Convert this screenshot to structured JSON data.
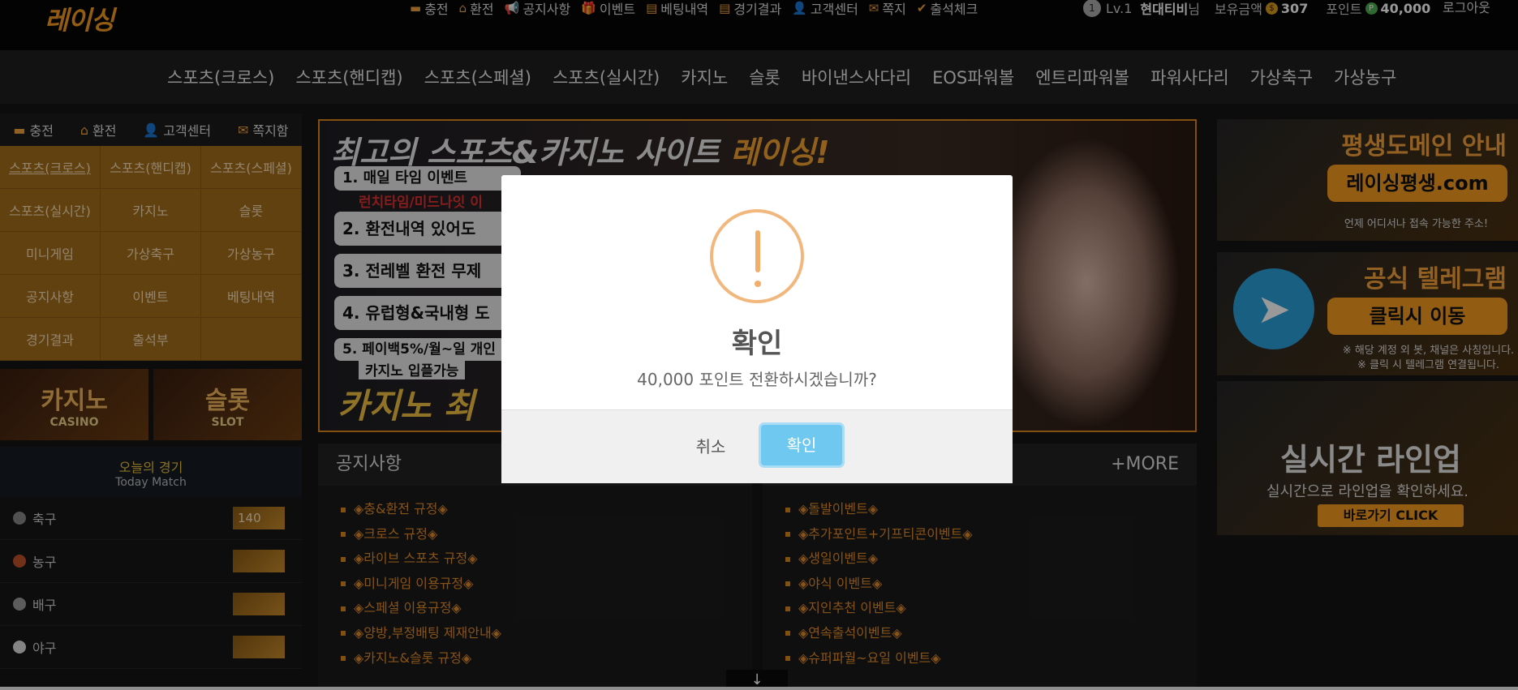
{
  "logo": {
    "text": "레이싱"
  },
  "toplinks": [
    {
      "icon": "card-icon",
      "glyph": "▬",
      "label": "충전"
    },
    {
      "icon": "exchange-icon",
      "glyph": "⌂",
      "label": "환전"
    },
    {
      "icon": "megaphone-icon",
      "glyph": "📢",
      "label": "공지사항"
    },
    {
      "icon": "gift-icon",
      "glyph": "🎁",
      "label": "이벤트"
    },
    {
      "icon": "doc-icon",
      "glyph": "▤",
      "label": "베팅내역"
    },
    {
      "icon": "doc2-icon",
      "glyph": "▤",
      "label": "경기결과"
    },
    {
      "icon": "support-icon",
      "glyph": "👤",
      "label": "고객센터"
    },
    {
      "icon": "ribbon-icon",
      "glyph": "✉",
      "label": "쪽지"
    },
    {
      "icon": "check-icon",
      "glyph": "✔",
      "label": "출석체크"
    }
  ],
  "user": {
    "level_badge": "1",
    "level": "Lv.1",
    "name": "현대티비",
    "suffix": "님",
    "balance_label": "보유금액",
    "balance": "307",
    "points_label": "포인트",
    "points": "40,000",
    "balance_coin": "$",
    "points_coin": "P"
  },
  "logout": "로그아웃",
  "mainnav": [
    "스포츠(크로스)",
    "스포츠(핸디캡)",
    "스포츠(스페셜)",
    "스포츠(실시간)",
    "카지노",
    "슬롯",
    "바이낸스사다리",
    "EOS파워볼",
    "엔트리파워볼",
    "파워사다리",
    "가상축구",
    "가상농구"
  ],
  "sidebar": {
    "quick": [
      {
        "icon": "card-icon",
        "glyph": "▬",
        "label": "충전"
      },
      {
        "icon": "exchange-icon",
        "glyph": "⌂",
        "label": "환전"
      },
      {
        "icon": "support-icon",
        "glyph": "👤",
        "label": "고객센터"
      },
      {
        "icon": "ribbon-icon",
        "glyph": "✉",
        "label": "쪽지함"
      }
    ],
    "grid": [
      "스포츠(크로스)",
      "스포츠(핸디캡)",
      "스포츠(스페셜)",
      "스포츠(실시간)",
      "카지노",
      "슬롯",
      "미니게임",
      "가상축구",
      "가상농구",
      "공지사항",
      "이벤트",
      "베팅내역",
      "경기결과",
      "출석부",
      ""
    ],
    "banners": [
      {
        "title": "카지노",
        "sub": "CASINO"
      },
      {
        "title": "슬롯",
        "sub": "SLOT"
      }
    ],
    "today": {
      "title": "오늘의 경기",
      "subtitle": "Today Match"
    },
    "sports": [
      {
        "name": "축구",
        "count": "140",
        "color": "#888"
      },
      {
        "name": "농구",
        "count": "",
        "color": "#c0502a"
      },
      {
        "name": "배구",
        "count": "",
        "color": "#999"
      },
      {
        "name": "야구",
        "count": "",
        "color": "#ddd"
      }
    ]
  },
  "hero": {
    "title_a": "최고의 스포츠&카지노 사이트",
    "title_b": "레이싱!",
    "items": [
      "1. 매일 타임 이벤트",
      "2. 환전내역 있어도",
      "3. 전레벨 환전 무제",
      "4. 유럽형&국내형 도",
      "5. 페이백5%/월~일 개인"
    ],
    "item1_sub": "런치타임/미드나잇 이",
    "item5_sub": "카지노 입플가능",
    "bottom": "카지노 최"
  },
  "rightbanners": [
    {
      "title": "평생도메인 안내",
      "button": "레이싱평생.com",
      "sub": "언제 어디서나 접속 가능한 주소!"
    },
    {
      "title": "공식 텔레그램",
      "button": "클릭시 이동",
      "sub": "※ 해당 계정 외 봇, 채널은 사칭입니다.",
      "sub2": "※ 클릭 시 텔레그램 연결됩니다."
    },
    {
      "title": "실시간 라인업",
      "button": "바로가기 CLICK",
      "sub": "실시간으로 라인업을 확인하세요."
    }
  ],
  "notice": {
    "title": "공지사항",
    "items": [
      "◈충&환전 규정◈",
      "◈크로스 규정◈",
      "◈라이브 스포츠 규정◈",
      "◈미니게임 이용규정◈",
      "◈스페셜 이용규정◈",
      "◈양방,부정배팅 제재안내◈",
      "◈카지노&슬롯 규정◈"
    ]
  },
  "events": {
    "more": "+MORE",
    "items": [
      "◈돌발이벤트◈",
      "◈추가포인트+기프티콘이벤트◈",
      "◈생일이벤트◈",
      "◈야식 이벤트◈",
      "◈지인추천 이벤트◈",
      "◈연속출석이벤트◈",
      "◈슈퍼파월~요일 이벤트◈"
    ]
  },
  "modal": {
    "title": "확인",
    "message": "40,000 포인트 전환하시겠습니까?",
    "cancel": "취소",
    "confirm": "확인"
  },
  "scroll_cue": "↓"
}
